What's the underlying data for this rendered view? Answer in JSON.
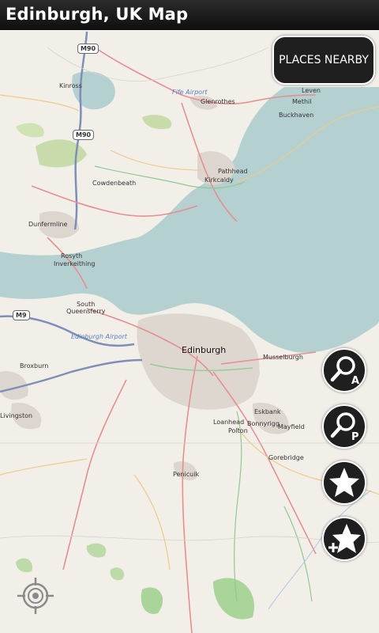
{
  "app": {
    "title": "Edinburgh, UK Map"
  },
  "buttons": {
    "places_nearby": "PLACES NEARBY",
    "search_address_letter": "A",
    "search_place_letter": "P"
  },
  "map": {
    "roads": [
      "M90",
      "M90",
      "M9"
    ],
    "places": {
      "kinross": "Kinross",
      "fife_airport": "Fife Airport",
      "glenrothes": "Glenrothes",
      "leven": "Leven",
      "methil": "Methil",
      "buckhaven": "Buckhaven",
      "pathhead": "Pathhead",
      "kirkcaldy": "Kirkcaldy",
      "cowdenbeath": "Cowdenbeath",
      "dunfermline": "Dunfermline",
      "rosyth": "Rosyth",
      "inverkeithing": "Inverkeithing",
      "south_queensferry": "South\nQueensferry",
      "edinburgh_airport": "Edinburgh Airport",
      "edinburgh": "Edinburgh",
      "musselburgh": "Musselburgh",
      "broxburn": "Broxburn",
      "livingston": "Livingston",
      "eskbank": "Eskbank",
      "loanhead": "Loanhead",
      "bonnyrigg": "Bonnyrigg",
      "mayfield": "Mayfield",
      "polton": "Polton",
      "gorebridge": "Gorebridge",
      "penicuik": "Penicuik"
    }
  }
}
